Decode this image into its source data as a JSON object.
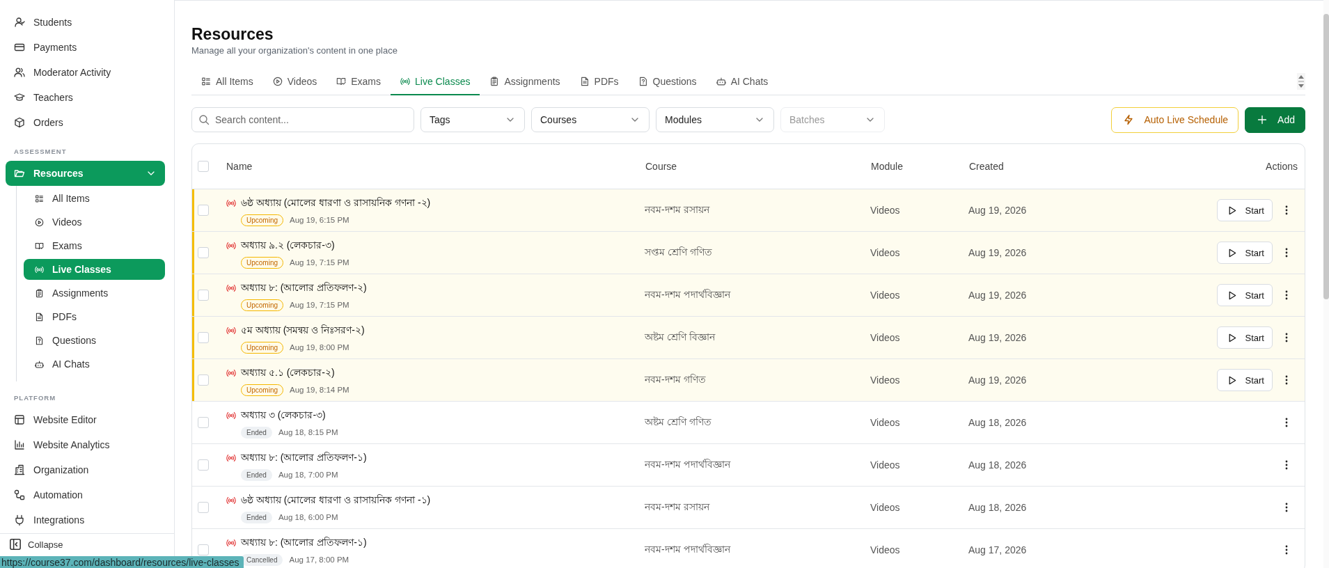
{
  "sidebar": {
    "groups": [
      {
        "items": [
          {
            "label": "Students"
          },
          {
            "label": "Payments"
          },
          {
            "label": "Moderator Activity"
          },
          {
            "label": "Teachers"
          },
          {
            "label": "Orders"
          }
        ]
      },
      {
        "label": "ASSESSMENT",
        "items": [
          {
            "label": "Resources",
            "selected": true,
            "expanded": true,
            "children": [
              {
                "label": "All Items",
                "selected": false
              },
              {
                "label": "Videos",
                "selected": false
              },
              {
                "label": "Exams",
                "selected": false
              },
              {
                "label": "Live Classes",
                "selected": true
              },
              {
                "label": "Assignments",
                "selected": false
              },
              {
                "label": "PDFs",
                "selected": false
              },
              {
                "label": "Questions",
                "selected": false
              },
              {
                "label": "AI Chats",
                "selected": false
              }
            ]
          }
        ]
      },
      {
        "label": "PLATFORM",
        "items": [
          {
            "label": "Website Editor"
          },
          {
            "label": "Website Analytics"
          },
          {
            "label": "Organization"
          },
          {
            "label": "Automation"
          },
          {
            "label": "Integrations"
          }
        ]
      }
    ],
    "footer": "Collapse"
  },
  "page": {
    "title": "Resources",
    "subtitle": "Manage all your organization's content in one place"
  },
  "tabs": [
    {
      "label": "All Items",
      "selected": false
    },
    {
      "label": "Videos",
      "selected": false
    },
    {
      "label": "Exams",
      "selected": false
    },
    {
      "label": "Live Classes",
      "selected": true
    },
    {
      "label": "Assignments",
      "selected": false
    },
    {
      "label": "PDFs",
      "selected": false
    },
    {
      "label": "Questions",
      "selected": false
    },
    {
      "label": "AI Chats",
      "selected": false
    }
  ],
  "toolbar": {
    "search": {
      "placeholder": "Search content..."
    },
    "filters": [
      {
        "label": "Tags",
        "disabled": false
      },
      {
        "label": "Courses",
        "disabled": false
      },
      {
        "label": "Modules",
        "disabled": false
      },
      {
        "label": "Batches",
        "disabled": true
      }
    ],
    "buttons": [
      {
        "kind": "outline",
        "label": "Auto Live Schedule"
      },
      {
        "kind": "primary",
        "label": "Add"
      }
    ]
  },
  "table": {
    "columns": [
      "Name",
      "Course",
      "Module",
      "Created",
      "Actions"
    ],
    "all_checked": false,
    "rows": [
      {
        "checked": false,
        "name": "৬ষ্ঠ অধ্যায় (মোলের ধারণা ও রাসায়নিক গণনা -২)",
        "kind": "upcoming",
        "status": "Upcoming",
        "time": "Aug 19, 6:15 PM",
        "course": "নবম-দশম রসায়ন",
        "module": "Videos",
        "created": "Aug 19, 2026",
        "action": "Start"
      },
      {
        "checked": false,
        "name": "অধ্যায় ৯.২ (লেকচার-৩)",
        "kind": "upcoming",
        "status": "Upcoming",
        "time": "Aug 19, 7:15 PM",
        "course": "সপ্তম শ্রেণি গণিত",
        "module": "Videos",
        "created": "Aug 19, 2026",
        "action": "Start"
      },
      {
        "checked": false,
        "name": "অধ্যায় ৮: (আলোর প্রতিফলণ-২)",
        "kind": "upcoming",
        "status": "Upcoming",
        "time": "Aug 19, 7:15 PM",
        "course": "নবম-দশম পদার্থবিজ্ঞান",
        "module": "Videos",
        "created": "Aug 19, 2026",
        "action": "Start"
      },
      {
        "checked": false,
        "name": "৫ম অধ্যায় (সমন্বয় ও নিঃসরণ-২)",
        "kind": "upcoming",
        "status": "Upcoming",
        "time": "Aug 19, 8:00 PM",
        "course": "অষ্টম শ্রেণি বিজ্ঞান",
        "module": "Videos",
        "created": "Aug 19, 2026",
        "action": "Start"
      },
      {
        "checked": false,
        "name": "অধ্যায় ৫.১ (লেকচার-২)",
        "kind": "upcoming",
        "status": "Upcoming",
        "time": "Aug 19, 8:14 PM",
        "course": "নবম-দশম গণিত",
        "module": "Videos",
        "created": "Aug 19, 2026",
        "action": "Start"
      },
      {
        "checked": false,
        "name": "অধ্যায় ৩ (লেকচার-৩)",
        "kind": "ended",
        "status": "Ended",
        "time": "Aug 18, 8:15 PM",
        "course": "অষ্টম শ্রেণি গণিত",
        "module": "Videos",
        "created": "Aug 18, 2026"
      },
      {
        "checked": false,
        "name": "অধ্যায় ৮: (আলোর প্রতিফলণ-১)",
        "kind": "ended",
        "status": "Ended",
        "time": "Aug 18, 7:00 PM",
        "course": "নবম-দশম পদার্থবিজ্ঞান",
        "module": "Videos",
        "created": "Aug 18, 2026"
      },
      {
        "checked": false,
        "name": "৬ষ্ঠ অধ্যায় (মোলের ধারণা ও রাসায়নিক গণনা -১)",
        "kind": "ended",
        "status": "Ended",
        "time": "Aug 18, 6:00 PM",
        "course": "নবম-দশম রসায়ন",
        "module": "Videos",
        "created": "Aug 18, 2026"
      },
      {
        "checked": false,
        "name": "অধ্যায় ৮: (আলোর প্রতিফলণ-১)",
        "kind": "cancelled",
        "status": "Cancelled",
        "time": "Aug 17, 8:00 PM",
        "course": "নবম-দশম পদার্থবিজ্ঞান",
        "module": "Videos",
        "created": "Aug 17, 2026"
      }
    ]
  },
  "status_url": "https://course37.com/dashboard/resources/live-classes"
}
